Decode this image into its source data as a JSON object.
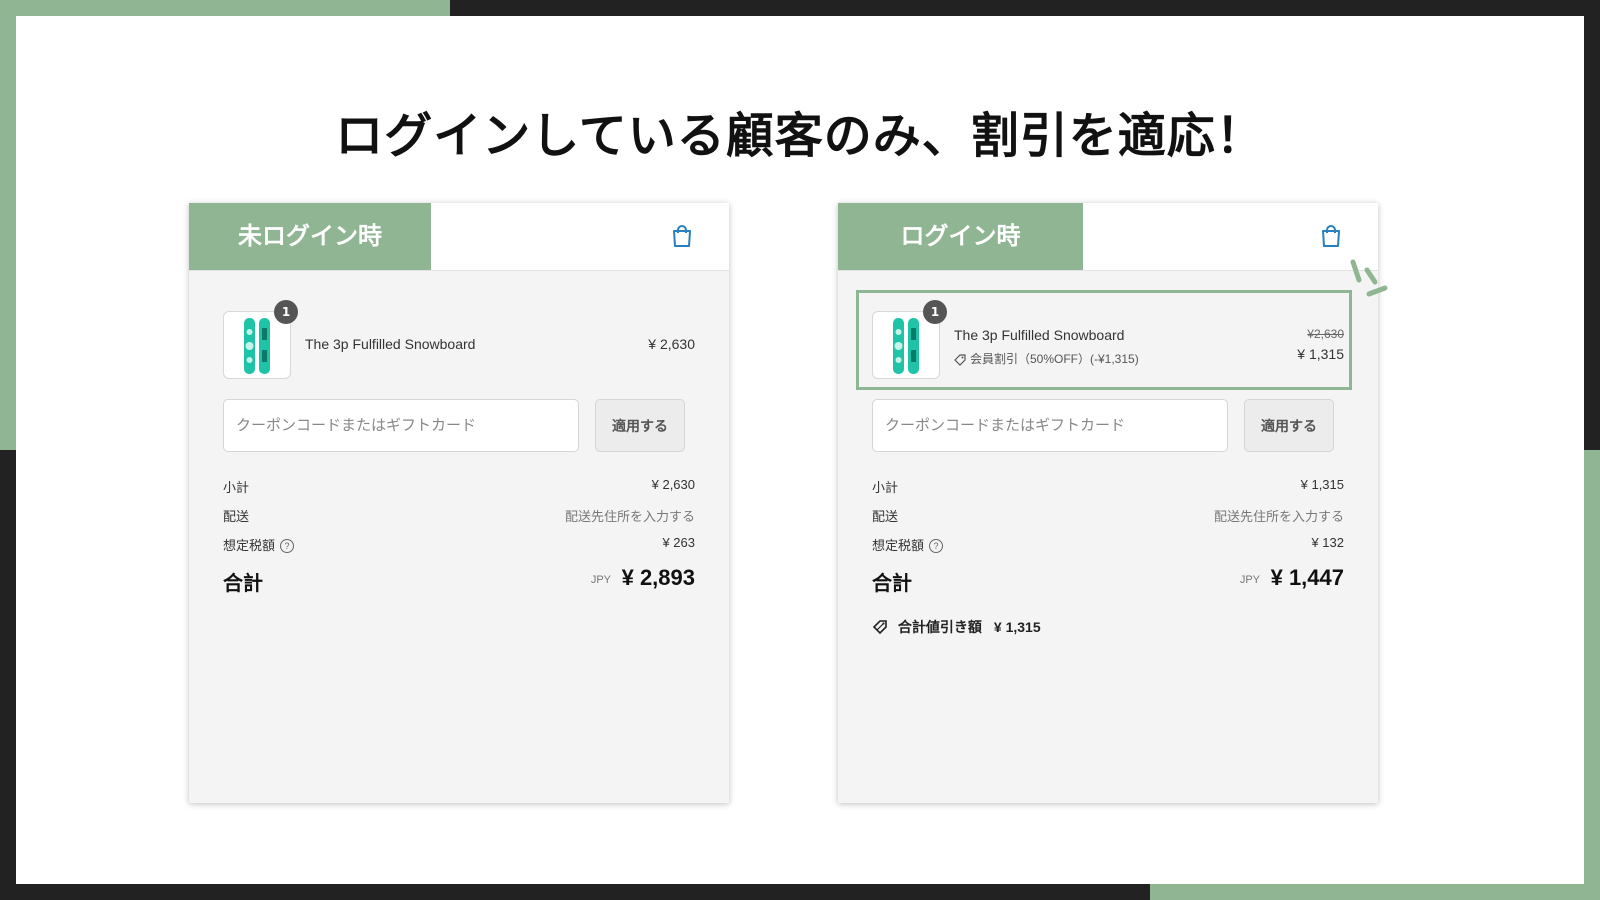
{
  "slide": {
    "title": "ログインしている顧客のみ、割引を適応！"
  },
  "colors": {
    "accent_green": "#8fb592",
    "frame_dark": "#222222"
  },
  "panels": [
    {
      "tab_label": "未ログイン時",
      "header_icon": "shopping-bag-icon",
      "item": {
        "quantity": "1",
        "name": "The 3p Fulfilled Snowboard",
        "price": "¥ 2,630"
      },
      "coupon": {
        "placeholder": "クーポンコードまたはギフトカード",
        "apply_label": "適用する"
      },
      "summary": {
        "subtotal_label": "小計",
        "subtotal_value": "¥ 2,630",
        "shipping_label": "配送",
        "shipping_value": "配送先住所を入力する",
        "tax_label": "想定税額",
        "tax_help": "?",
        "tax_value": "¥ 263",
        "total_label": "合計",
        "total_currency": "JPY",
        "total_value": "¥ 2,893"
      }
    },
    {
      "tab_label": "ログイン時",
      "header_icon": "shopping-bag-icon",
      "item": {
        "quantity": "1",
        "name": "The 3p Fulfilled Snowboard",
        "discount_text": "会員割引（50%OFF）(-¥1,315)",
        "original_price": "¥2,630",
        "discounted_price": "¥ 1,315"
      },
      "coupon": {
        "placeholder": "クーポンコードまたはギフトカード",
        "apply_label": "適用する"
      },
      "summary": {
        "subtotal_label": "小計",
        "subtotal_value": "¥ 1,315",
        "shipping_label": "配送",
        "shipping_value": "配送先住所を入力する",
        "tax_label": "想定税額",
        "tax_help": "?",
        "tax_value": "¥ 132",
        "total_label": "合計",
        "total_currency": "JPY",
        "total_value": "¥ 1,447",
        "savings_label": "合計値引き額",
        "savings_value": "¥ 1,315"
      }
    }
  ]
}
